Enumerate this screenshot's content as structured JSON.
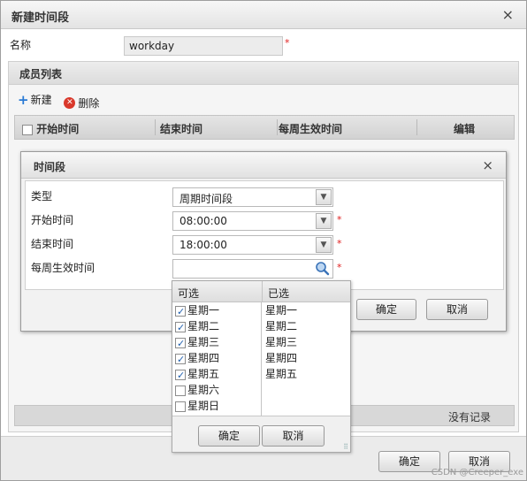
{
  "outer": {
    "title": "新建时间段",
    "close": "×",
    "name_label": "名称",
    "name_value": "workday",
    "required": "*",
    "members_title": "成员列表",
    "toolbar": {
      "new_label": "新建",
      "delete_label": "删除"
    },
    "columns": [
      "开始时间",
      "结束时间",
      "每周生效时间",
      "编辑"
    ],
    "empty_text": "没有记录",
    "ok_label": "确定",
    "cancel_label": "取消"
  },
  "inner": {
    "title": "时间段",
    "close": "×",
    "type_label": "类型",
    "type_value": "周期时间段",
    "start_label": "开始时间",
    "start_value": "08:00:00",
    "end_label": "结束时间",
    "end_value": "18:00:00",
    "weekly_label": "每周生效时间",
    "weekly_value": "",
    "ok_label": "确定",
    "cancel_label": "取消"
  },
  "picker": {
    "available_header": "可选",
    "selected_header": "已选",
    "available": [
      {
        "label": "星期一",
        "checked": true
      },
      {
        "label": "星期二",
        "checked": true
      },
      {
        "label": "星期三",
        "checked": true
      },
      {
        "label": "星期四",
        "checked": true
      },
      {
        "label": "星期五",
        "checked": true
      },
      {
        "label": "星期六",
        "checked": false
      },
      {
        "label": "星期日",
        "checked": false
      }
    ],
    "selected": [
      "星期一",
      "星期二",
      "星期三",
      "星期四",
      "星期五"
    ],
    "ok_label": "确定",
    "cancel_label": "取消"
  },
  "watermark": "CSDN @Creeper_exe"
}
